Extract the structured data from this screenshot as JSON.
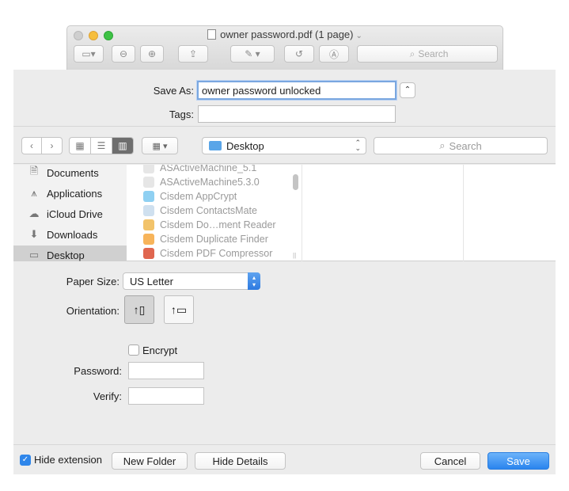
{
  "window": {
    "title": "owner password.pdf (1 page)",
    "toolbar_search_placeholder": "Search"
  },
  "save_as": {
    "label": "Save As:",
    "value": "owner password unlocked",
    "tags_label": "Tags:",
    "tags_value": ""
  },
  "navigation": {
    "location": "Desktop",
    "search_placeholder": "Search"
  },
  "sidebar": {
    "items": [
      {
        "label": "Documents",
        "icon": "document-icon"
      },
      {
        "label": "Applications",
        "icon": "applications-icon"
      },
      {
        "label": "iCloud Drive",
        "icon": "cloud-icon"
      },
      {
        "label": "Downloads",
        "icon": "download-icon"
      },
      {
        "label": "Desktop",
        "icon": "desktop-icon",
        "selected": true
      }
    ]
  },
  "files": [
    "ASActiveMachine_5.1",
    "ASActiveMachine5.3.0",
    "Cisdem AppCrypt",
    "Cisdem ContactsMate",
    "Cisdem Do…ment Reader",
    "Cisdem Duplicate Finder",
    "Cisdem PDF Compressor"
  ],
  "options": {
    "paper_size_label": "Paper Size:",
    "paper_size_value": "US Letter",
    "orientation_label": "Orientation:",
    "encrypt_label": "Encrypt",
    "encrypt_checked": false,
    "password_label": "Password:",
    "verify_label": "Verify:"
  },
  "bottom": {
    "hide_extension_label": "Hide extension",
    "hide_extension_checked": true,
    "new_folder": "New Folder",
    "hide_details": "Hide Details",
    "cancel": "Cancel",
    "save": "Save"
  },
  "colors": {
    "accent": "#2a84ee",
    "sheet_bg": "#ececec"
  }
}
